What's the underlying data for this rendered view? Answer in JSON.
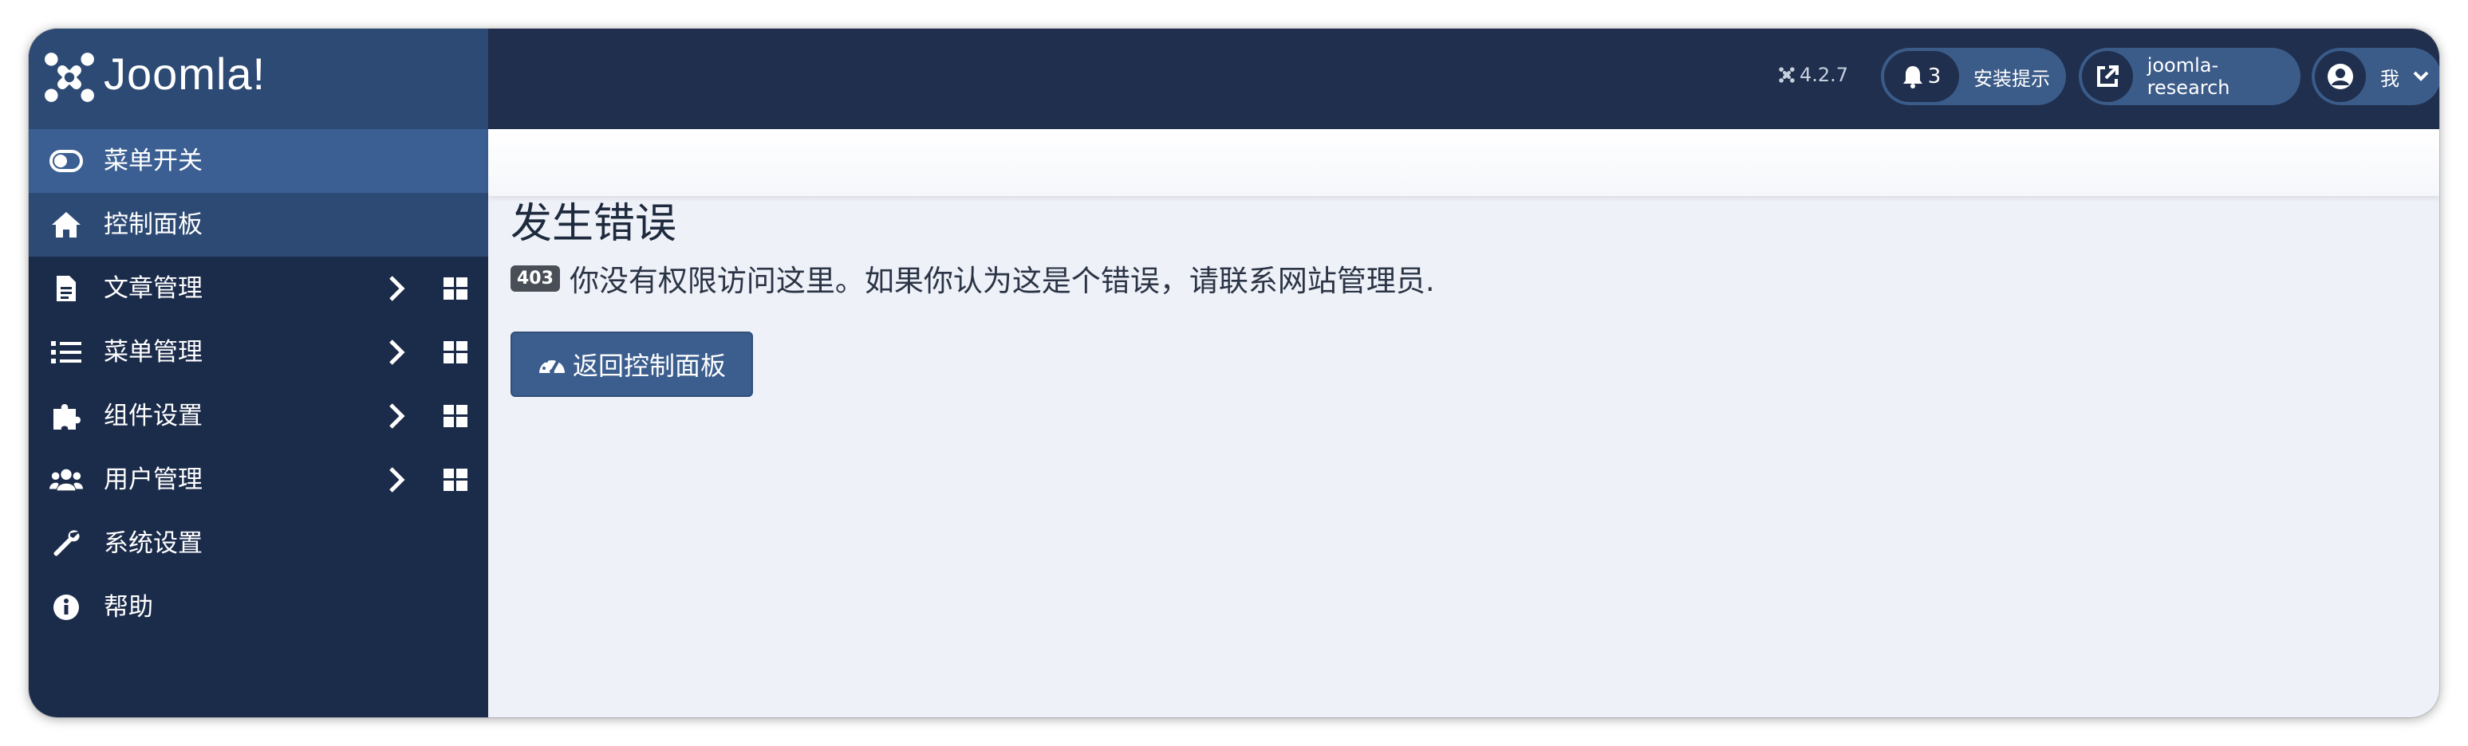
{
  "brand": {
    "name": "Joomla!"
  },
  "sidebar": {
    "items": [
      {
        "label": "菜单开关",
        "icon": "toggle-icon"
      },
      {
        "label": "控制面板",
        "icon": "home-icon"
      },
      {
        "label": "文章管理",
        "icon": "file-icon"
      },
      {
        "label": "菜单管理",
        "icon": "list-icon"
      },
      {
        "label": "组件设置",
        "icon": "puzzle-icon"
      },
      {
        "label": "用户管理",
        "icon": "users-icon"
      },
      {
        "label": "系统设置",
        "icon": "wrench-icon"
      },
      {
        "label": "帮助",
        "icon": "info-icon"
      }
    ]
  },
  "topbar": {
    "version": "4.2.7",
    "notifications": {
      "count": "3",
      "label": "安装提示"
    },
    "site": {
      "label": "joomla-research"
    },
    "user": {
      "label": "我"
    }
  },
  "main": {
    "title": "发生错误",
    "error_code": "403",
    "message": "你没有权限访问这里。如果你认为这是个错误，请联系网站管理员.",
    "back_button": "返回控制面板"
  },
  "colors": {
    "sidebar_bg": "#1b2b4a",
    "brand_bg": "#2d4a74",
    "topbar_bg": "#1f2f4d",
    "content_bg": "#eef1f8",
    "button_bg": "#3b5e8e"
  }
}
